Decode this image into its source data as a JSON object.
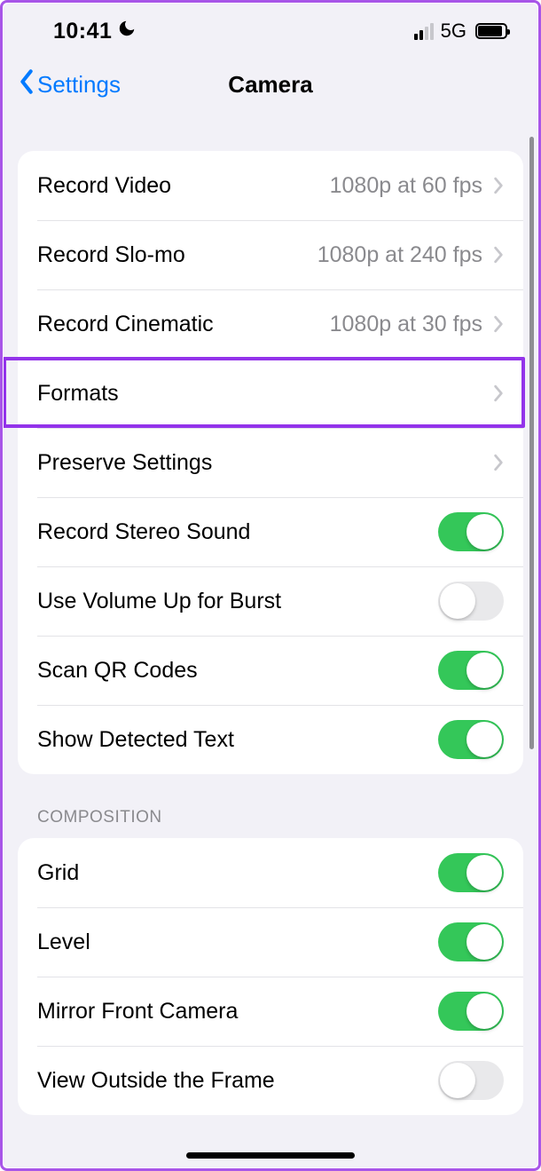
{
  "status": {
    "time": "10:41",
    "network": "5G"
  },
  "nav": {
    "back": "Settings",
    "title": "Camera"
  },
  "groups": {
    "main": {
      "items": [
        {
          "label": "Record Video",
          "value": "1080p at 60 fps",
          "kind": "nav"
        },
        {
          "label": "Record Slo-mo",
          "value": "1080p at 240 fps",
          "kind": "nav"
        },
        {
          "label": "Record Cinematic",
          "value": "1080p at 30 fps",
          "kind": "nav"
        },
        {
          "label": "Formats",
          "value": "",
          "kind": "nav",
          "highlighted": true
        },
        {
          "label": "Preserve Settings",
          "value": "",
          "kind": "nav"
        },
        {
          "label": "Record Stereo Sound",
          "kind": "toggle",
          "on": true
        },
        {
          "label": "Use Volume Up for Burst",
          "kind": "toggle",
          "on": false
        },
        {
          "label": "Scan QR Codes",
          "kind": "toggle",
          "on": true
        },
        {
          "label": "Show Detected Text",
          "kind": "toggle",
          "on": true
        }
      ]
    },
    "composition": {
      "header": "COMPOSITION",
      "items": [
        {
          "label": "Grid",
          "kind": "toggle",
          "on": true
        },
        {
          "label": "Level",
          "kind": "toggle",
          "on": true
        },
        {
          "label": "Mirror Front Camera",
          "kind": "toggle",
          "on": true
        },
        {
          "label": "View Outside the Frame",
          "kind": "toggle",
          "on": false
        }
      ]
    }
  }
}
